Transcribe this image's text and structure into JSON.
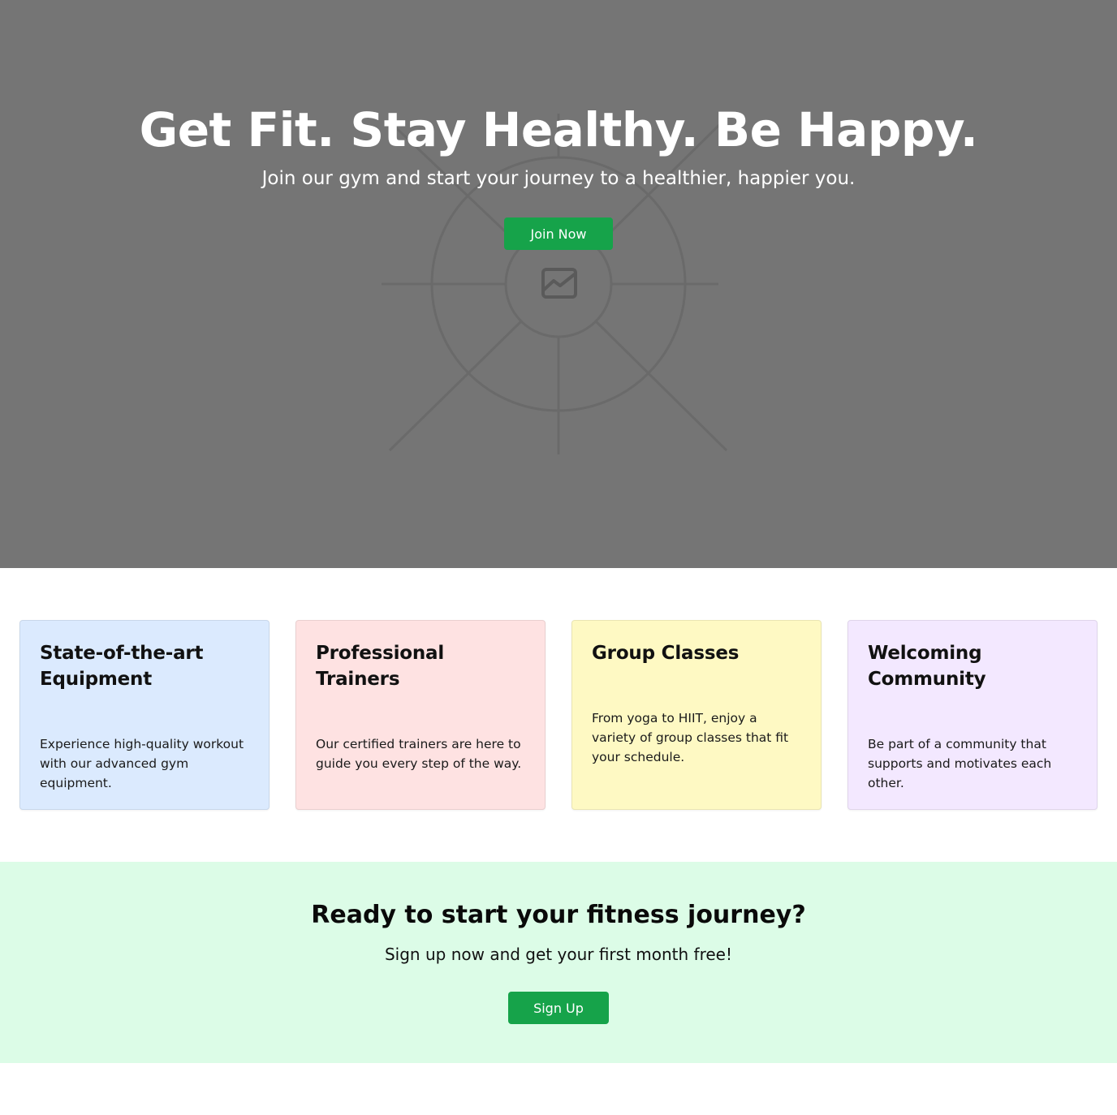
{
  "hero": {
    "title": "Get Fit. Stay Healthy. Be Happy.",
    "subtitle": "Join our gym and start your journey to a healthier, happier you.",
    "join_button": "Join Now",
    "background_image_icon": "image-placeholder-icon",
    "background_color": "#757575"
  },
  "features": [
    {
      "title": "State-of-the-art Equipment",
      "description": "Experience high-quality workout with our advanced gym equipment.",
      "color": "#dbeafe"
    },
    {
      "title": "Professional Trainers",
      "description": "Our certified trainers are here to guide you every step of the way.",
      "color": "#fee2e2"
    },
    {
      "title": "Group Classes",
      "description": "From yoga to HIIT, enjoy a variety of group classes that fit your schedule.",
      "color": "#fef9c3"
    },
    {
      "title": "Welcoming Community",
      "description": "Be part of a community that supports and motivates each other.",
      "color": "#f3e8ff"
    }
  ],
  "cta": {
    "title": "Ready to start your fitness journey?",
    "subtitle": "Sign up now and get your first month free!",
    "signup_button": "Sign Up",
    "background_color": "#dcfce7"
  },
  "accent_color": "#16a34a"
}
